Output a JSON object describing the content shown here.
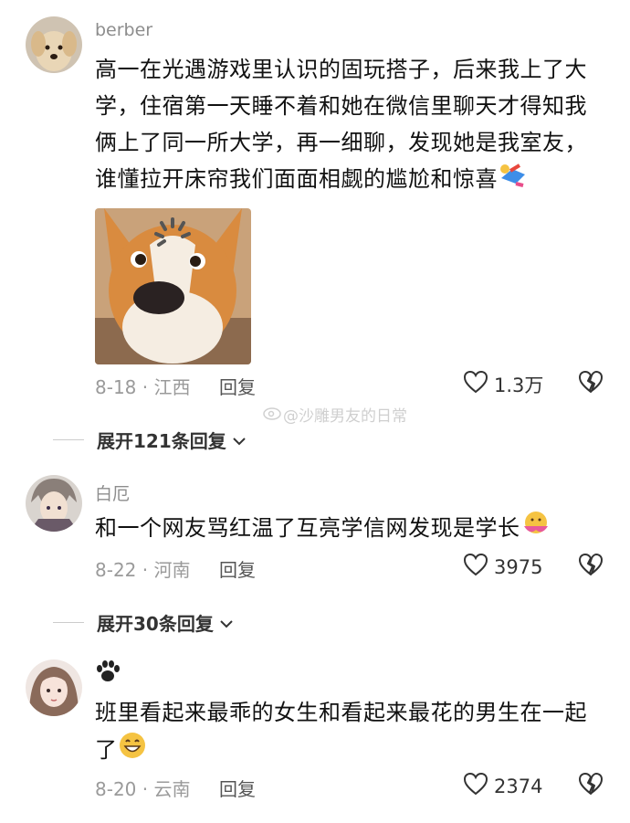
{
  "comments": [
    {
      "author": "berber",
      "text": "高一在光遇游戏里认识的固玩搭子，后来我上了大学，住宿第一天睡不着和她在微信里聊天才得知我俩上了同一所大学，再一细聊，发现她是我室友，谁懂拉开床帘我们面面相觑的尴尬和惊喜",
      "date_location": "8-18 · 江西",
      "reply_label": "回复",
      "likes": "1.3万",
      "expand_label": "展开121条回复"
    },
    {
      "author": "白厄",
      "text": "和一个网友骂红温了互亮学信网发现是学长",
      "date_location": "8-22 · 河南",
      "reply_label": "回复",
      "likes": "3975",
      "expand_label": "展开30条回复"
    },
    {
      "author": "🐾",
      "text": "班里看起来最乖的女生和看起来最花的男生在一起了",
      "date_location": "8-20 · 云南",
      "reply_label": "回复",
      "likes": "2374"
    }
  ],
  "watermark": "@沙雕男友的日常",
  "colors": {
    "meta": "#9a9a9a",
    "text": "#111111",
    "corgi": "#d98b3f"
  }
}
